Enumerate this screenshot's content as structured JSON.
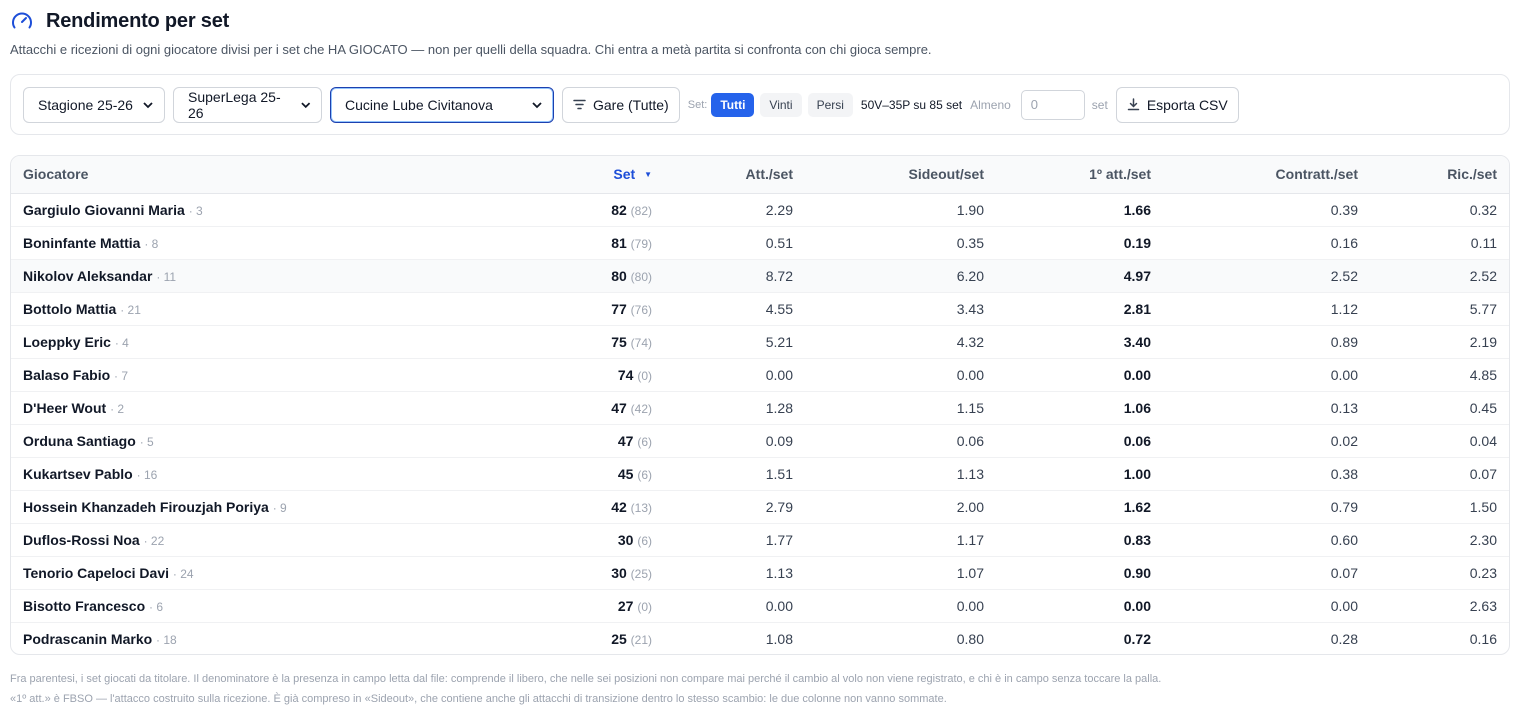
{
  "header": {
    "title": "Rendimento per set",
    "subtitle": "Attacchi e ricezioni di ogni giocatore divisi per i set che HA GIOCATO — non per quelli della squadra. Chi entra a metà partita si confronta con chi gioca sempre."
  },
  "toolbar": {
    "season": "Stagione 25-26",
    "league": "SuperLega 25-26",
    "team": "Cucine Lube Civitanova",
    "games_button": "Gare (Tutte)",
    "set_label": "Set:",
    "chips": [
      "Tutti",
      "Vinti",
      "Persi"
    ],
    "summary": "50V–35P su 85 set",
    "almeno_label": "Almeno",
    "min_sets_value": "0",
    "set_suffix": "set",
    "export_button": "Esporta CSV"
  },
  "table": {
    "headers": {
      "player": "Giocatore",
      "set": "Set",
      "sort_indicator": "▼",
      "att": "Att./set",
      "sideout": "Sideout/set",
      "first_att": "1º att./set",
      "counter": "Contratt./set",
      "ric": "Ric./set"
    },
    "rows": [
      {
        "name": "Gargiulo Giovanni Maria",
        "num": "· 3",
        "set": "82",
        "starter": "(82)",
        "att": "2.29",
        "sideout": "1.90",
        "first_att": "1.66",
        "counter": "0.39",
        "ric": "0.32"
      },
      {
        "name": "Boninfante Mattia",
        "num": "· 8",
        "set": "81",
        "starter": "(79)",
        "att": "0.51",
        "sideout": "0.35",
        "first_att": "0.19",
        "counter": "0.16",
        "ric": "0.11"
      },
      {
        "name": "Nikolov Aleksandar",
        "num": "· 11",
        "set": "80",
        "starter": "(80)",
        "att": "8.72",
        "sideout": "6.20",
        "first_att": "4.97",
        "counter": "2.52",
        "ric": "2.52"
      },
      {
        "name": "Bottolo Mattia",
        "num": "· 21",
        "set": "77",
        "starter": "(76)",
        "att": "4.55",
        "sideout": "3.43",
        "first_att": "2.81",
        "counter": "1.12",
        "ric": "5.77"
      },
      {
        "name": "Loeppky Eric",
        "num": "· 4",
        "set": "75",
        "starter": "(74)",
        "att": "5.21",
        "sideout": "4.32",
        "first_att": "3.40",
        "counter": "0.89",
        "ric": "2.19"
      },
      {
        "name": "Balaso Fabio",
        "num": "· 7",
        "set": "74",
        "starter": "(0)",
        "att": "0.00",
        "sideout": "0.00",
        "first_att": "0.00",
        "counter": "0.00",
        "ric": "4.85"
      },
      {
        "name": "D'Heer Wout",
        "num": "· 2",
        "set": "47",
        "starter": "(42)",
        "att": "1.28",
        "sideout": "1.15",
        "first_att": "1.06",
        "counter": "0.13",
        "ric": "0.45"
      },
      {
        "name": "Orduna Santiago",
        "num": "· 5",
        "set": "47",
        "starter": "(6)",
        "att": "0.09",
        "sideout": "0.06",
        "first_att": "0.06",
        "counter": "0.02",
        "ric": "0.04"
      },
      {
        "name": "Kukartsev Pablo",
        "num": "· 16",
        "set": "45",
        "starter": "(6)",
        "att": "1.51",
        "sideout": "1.13",
        "first_att": "1.00",
        "counter": "0.38",
        "ric": "0.07"
      },
      {
        "name": "Hossein Khanzadeh Firouzjah Poriya",
        "num": "· 9",
        "set": "42",
        "starter": "(13)",
        "att": "2.79",
        "sideout": "2.00",
        "first_att": "1.62",
        "counter": "0.79",
        "ric": "1.50"
      },
      {
        "name": "Duflos-Rossi Noa",
        "num": "· 22",
        "set": "30",
        "starter": "(6)",
        "att": "1.77",
        "sideout": "1.17",
        "first_att": "0.83",
        "counter": "0.60",
        "ric": "2.30"
      },
      {
        "name": "Tenorio Capeloci Davi",
        "num": "· 24",
        "set": "30",
        "starter": "(25)",
        "att": "1.13",
        "sideout": "1.07",
        "first_att": "0.90",
        "counter": "0.07",
        "ric": "0.23"
      },
      {
        "name": "Bisotto Francesco",
        "num": "· 6",
        "set": "27",
        "starter": "(0)",
        "att": "0.00",
        "sideout": "0.00",
        "first_att": "0.00",
        "counter": "0.00",
        "ric": "2.63"
      },
      {
        "name": "Podrascanin Marko",
        "num": "· 18",
        "set": "25",
        "starter": "(21)",
        "att": "1.08",
        "sideout": "0.80",
        "first_att": "0.72",
        "counter": "0.28",
        "ric": "0.16"
      }
    ]
  },
  "notes": [
    "Fra parentesi, i set giocati da titolare. Il denominatore è la presenza in campo letta dal file: comprende il libero, che nelle sei posizioni non compare mai perché il cambio al volo non viene registrato, e chi è in campo senza toccare la palla.",
    "«1º att.» è FBSO — l'attacco costruito sulla ricezione. È già compreso in «Sideout», che contiene anche gli attacchi di transizione dentro lo stesso scambio: le due colonne non vanno sommate."
  ],
  "colors": {
    "accent": "#2563eb",
    "title_icon": "#1d4ed8"
  }
}
